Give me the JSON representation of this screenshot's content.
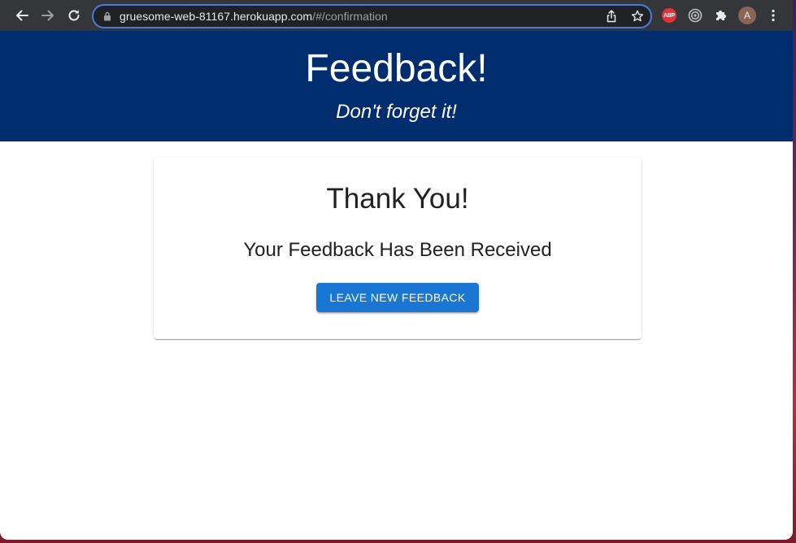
{
  "browser": {
    "url_host": "gruesome-web-81167.herokuapp.com",
    "url_path": "/#/confirmation",
    "extensions": [
      {
        "name": "adblock-plus",
        "label": "ABP"
      },
      {
        "name": "target-extension",
        "label": ""
      },
      {
        "name": "extensions-puzzle",
        "label": ""
      }
    ],
    "profile_initial": "A"
  },
  "header": {
    "title": "Feedback!",
    "subtitle": "Don't forget it!"
  },
  "confirmation": {
    "title": "Thank You!",
    "message": "Your Feedback Has Been Received",
    "button_label": "Leave New Feedback"
  },
  "colors": {
    "header_bg": "#002d6e",
    "button_bg": "#1976d2",
    "toolbar_bg": "#35363a",
    "omnibox_border": "#4b7be0"
  }
}
